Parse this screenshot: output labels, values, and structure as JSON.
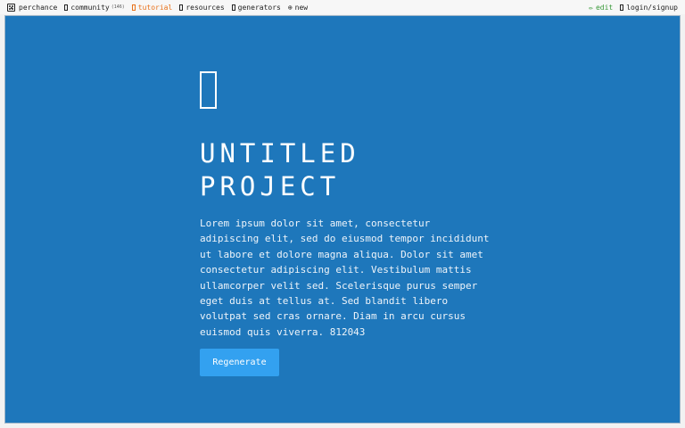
{
  "topbar": {
    "brand": {
      "label": "perchance",
      "icon": "dice-icon"
    },
    "community": {
      "label": "community",
      "count": "(146)",
      "icon": "chat-icon"
    },
    "tutorial": {
      "label": "tutorial",
      "icon": "book-icon",
      "color": "#e8711a"
    },
    "resources": {
      "label": "resources",
      "icon": "folder-icon"
    },
    "generators": {
      "label": "generators",
      "icon": "grid-icon"
    },
    "new": {
      "label": "new",
      "icon": "plus-circle-icon"
    },
    "edit": {
      "label": "edit",
      "icon": "pencil-icon",
      "color": "#3a9a3a"
    },
    "login": {
      "label": "login/signup",
      "icon": "user-icon"
    }
  },
  "main": {
    "background": "#1e77bb",
    "icon": "missing-glyph-icon",
    "title": "UNTITLED PROJECT",
    "description": "Lorem ipsum dolor sit amet, consectetur adipiscing elit, sed do eiusmod tempor incididunt ut labore et dolore magna aliqua. Dolor sit amet consectetur adipiscing elit. Vestibulum mattis ullamcorper velit sed. Scelerisque purus semper eget duis at tellus at. Sed blandit libero volutpat sed cras ornare. Diam in arcu cursus euismod quis viverra. 812043",
    "button_label": "Regenerate",
    "button_color": "#33a1f0"
  }
}
